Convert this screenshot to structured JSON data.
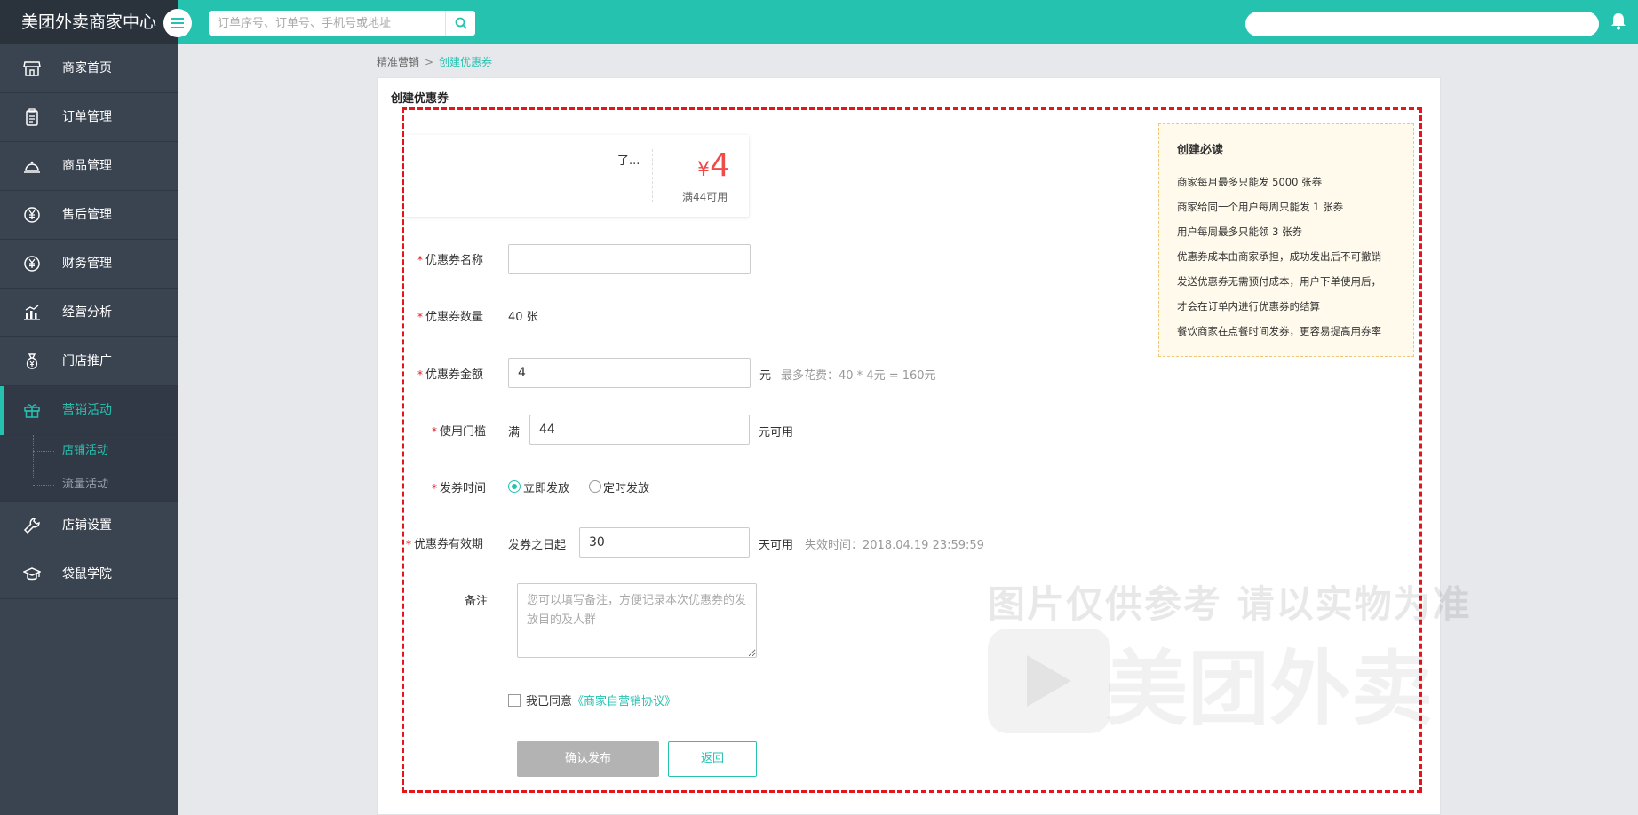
{
  "app": {
    "title": "美团外卖商家中心"
  },
  "search": {
    "placeholder": "订单序号、订单号、手机号或地址"
  },
  "sidebar": {
    "items": [
      {
        "label": "商家首页",
        "icon": "storefront-icon"
      },
      {
        "label": "订单管理",
        "icon": "clipboard-icon"
      },
      {
        "label": "商品管理",
        "icon": "cloche-icon"
      },
      {
        "label": "售后管理",
        "icon": "yen-circle-icon"
      },
      {
        "label": "财务管理",
        "icon": "yen-circle-icon"
      },
      {
        "label": "经营分析",
        "icon": "bar-chart-icon"
      },
      {
        "label": "门店推广",
        "icon": "money-bag-icon"
      },
      {
        "label": "营销活动",
        "icon": "gift-icon",
        "active": true
      },
      {
        "label": "店铺设置",
        "icon": "wrench-icon"
      },
      {
        "label": "袋鼠学院",
        "icon": "graduation-cap-icon"
      }
    ],
    "sub_items": [
      {
        "label": "店铺活动",
        "active": true
      },
      {
        "label": "流量活动"
      }
    ]
  },
  "breadcrumb": {
    "parent": "精准营销",
    "separator": ">",
    "current": "创建优惠券"
  },
  "panel": {
    "title": "创建优惠券"
  },
  "preview": {
    "shop_name": "了...",
    "yen": "¥",
    "amount": "4",
    "condition": "满44可用"
  },
  "form": {
    "name_label": "优惠券名称",
    "name_value": "",
    "quantity_label": "优惠券数量",
    "quantity_value": "40 张",
    "amount_label": "优惠券金额",
    "amount_value": "4",
    "amount_unit": "元",
    "amount_hint": "最多花费：40 * 4元 = 160元",
    "threshold_label": "使用门槛",
    "threshold_prefix": "满",
    "threshold_value": "44",
    "threshold_suffix": "元可用",
    "time_label": "发券时间",
    "time_options": [
      "立即发放",
      "定时发放"
    ],
    "time_selected": "立即发放",
    "validity_label": "优惠券有效期",
    "validity_prefix": "发券之日起",
    "validity_value": "30",
    "validity_suffix": "天可用",
    "validity_hint": "失效时间：2018.04.19 23:59:59",
    "remark_label": "备注",
    "remark_placeholder": "您可以填写备注，方便记录本次优惠券的发放目的及人群",
    "agree_text": "我已同意",
    "agree_link": "《商家自营销协议》",
    "agree_checked": false,
    "required_mark": "*",
    "confirm_label": "确认发布",
    "back_label": "返回"
  },
  "notice": {
    "title": "创建必读",
    "items": [
      "商家每月最多只能发 5000 张券",
      "商家给同一个用户每周只能发 1 张券",
      "用户每周最多只能领 3 张券",
      "优惠券成本由商家承担，成功发出后不可撤销",
      "发送优惠券无需预付成本，用户下单使用后，",
      "才会在订单内进行优惠券的结算",
      "餐饮商家在点餐时间发券，更容易提高用券率"
    ]
  },
  "watermark": {
    "line1": "图片仅供参考 请以实物为准",
    "brand": "美团外卖"
  },
  "colors": {
    "accent": "#26c2b0",
    "sidebar": "#3a4350",
    "required": "#e6151c",
    "price": "#ef4b48",
    "annotation_frame": "#e6151c"
  }
}
